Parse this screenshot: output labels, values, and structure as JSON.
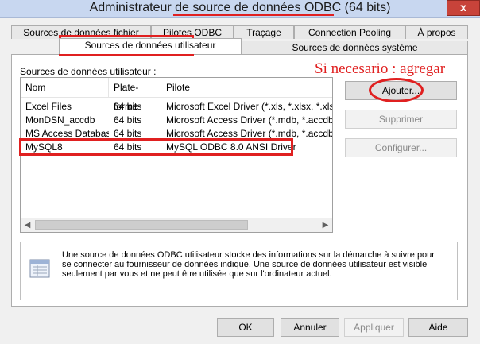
{
  "window": {
    "title": "Administrateur de source de données ODBC (64 bits)",
    "close_label": "x"
  },
  "tabs": {
    "row1": [
      "Sources de données fichier",
      "Pilotes ODBC",
      "Traçage",
      "Connection Pooling",
      "À propos"
    ],
    "row2": [
      "Sources de données utilisateur",
      "Sources de données système"
    ]
  },
  "panel": {
    "label": "Sources de données utilisateur :",
    "columns": [
      "Nom",
      "Plate-forme",
      "Pilote"
    ],
    "rows": [
      {
        "name": "Excel Files",
        "platform": "64 bits",
        "driver": "Microsoft Excel Driver (*.xls, *.xlsx, *.xlsm, *.xlsb)"
      },
      {
        "name": "MonDSN_accdb",
        "platform": "64 bits",
        "driver": "Microsoft Access Driver (*.mdb, *.accdb)"
      },
      {
        "name": "MS Access Database",
        "platform": "64 bits",
        "driver": "Microsoft Access Driver (*.mdb, *.accdb)"
      },
      {
        "name": "MySQL8",
        "platform": "64 bits",
        "driver": "MySQL ODBC 8.0 ANSI Driver"
      }
    ]
  },
  "buttons": {
    "add": "Ajouter...",
    "remove": "Supprimer",
    "configure": "Configurer...",
    "ok": "OK",
    "cancel": "Annuler",
    "apply": "Appliquer",
    "help": "Aide"
  },
  "info": {
    "text": "Une source de données ODBC utilisateur stocke des informations sur la démarche à suivre pour se connecter au fournisseur de données indiqué. Une source de données utilisateur est visible seulement par vous et ne peut être utilisée que sur l'ordinateur actuel."
  },
  "annotation": {
    "note": "Si necesario : agregar",
    "color": "#e02020"
  }
}
